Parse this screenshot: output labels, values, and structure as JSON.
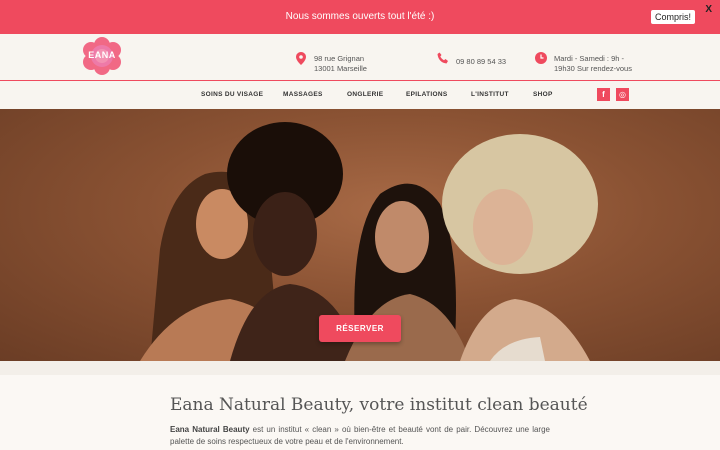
{
  "banner": {
    "text": "Nous sommes ouverts tout l'été :)",
    "close": "X",
    "ok": "Compris!"
  },
  "header": {
    "logo_text": "EANA",
    "address_line1": "98 rue Grignan",
    "address_line2": "13001 Marseille",
    "phone": "09 80 89 54 33",
    "hours_line1": "Mardi - Samedi : 9h -",
    "hours_line2": "19h30 Sur rendez-vous"
  },
  "nav": {
    "items": [
      "SOINS DU VISAGE",
      "MASSAGES",
      "ONGLERIE",
      "EPILATIONS",
      "L'INSTITUT",
      "SHOP"
    ],
    "facebook": "f",
    "instagram": "◎"
  },
  "hero": {
    "button": "RÉSERVER"
  },
  "content": {
    "title": "Eana Natural Beauty, votre institut clean beauté",
    "brand": "Eana Natural Beauty",
    "text": " est un institut « clean » où bien-être et beauté vont de pair. Découvrez une large palette de soins respectueux de votre peau et de l'environnement."
  },
  "colors": {
    "accent": "#ef4a5e",
    "background": "#f8f5f0"
  }
}
